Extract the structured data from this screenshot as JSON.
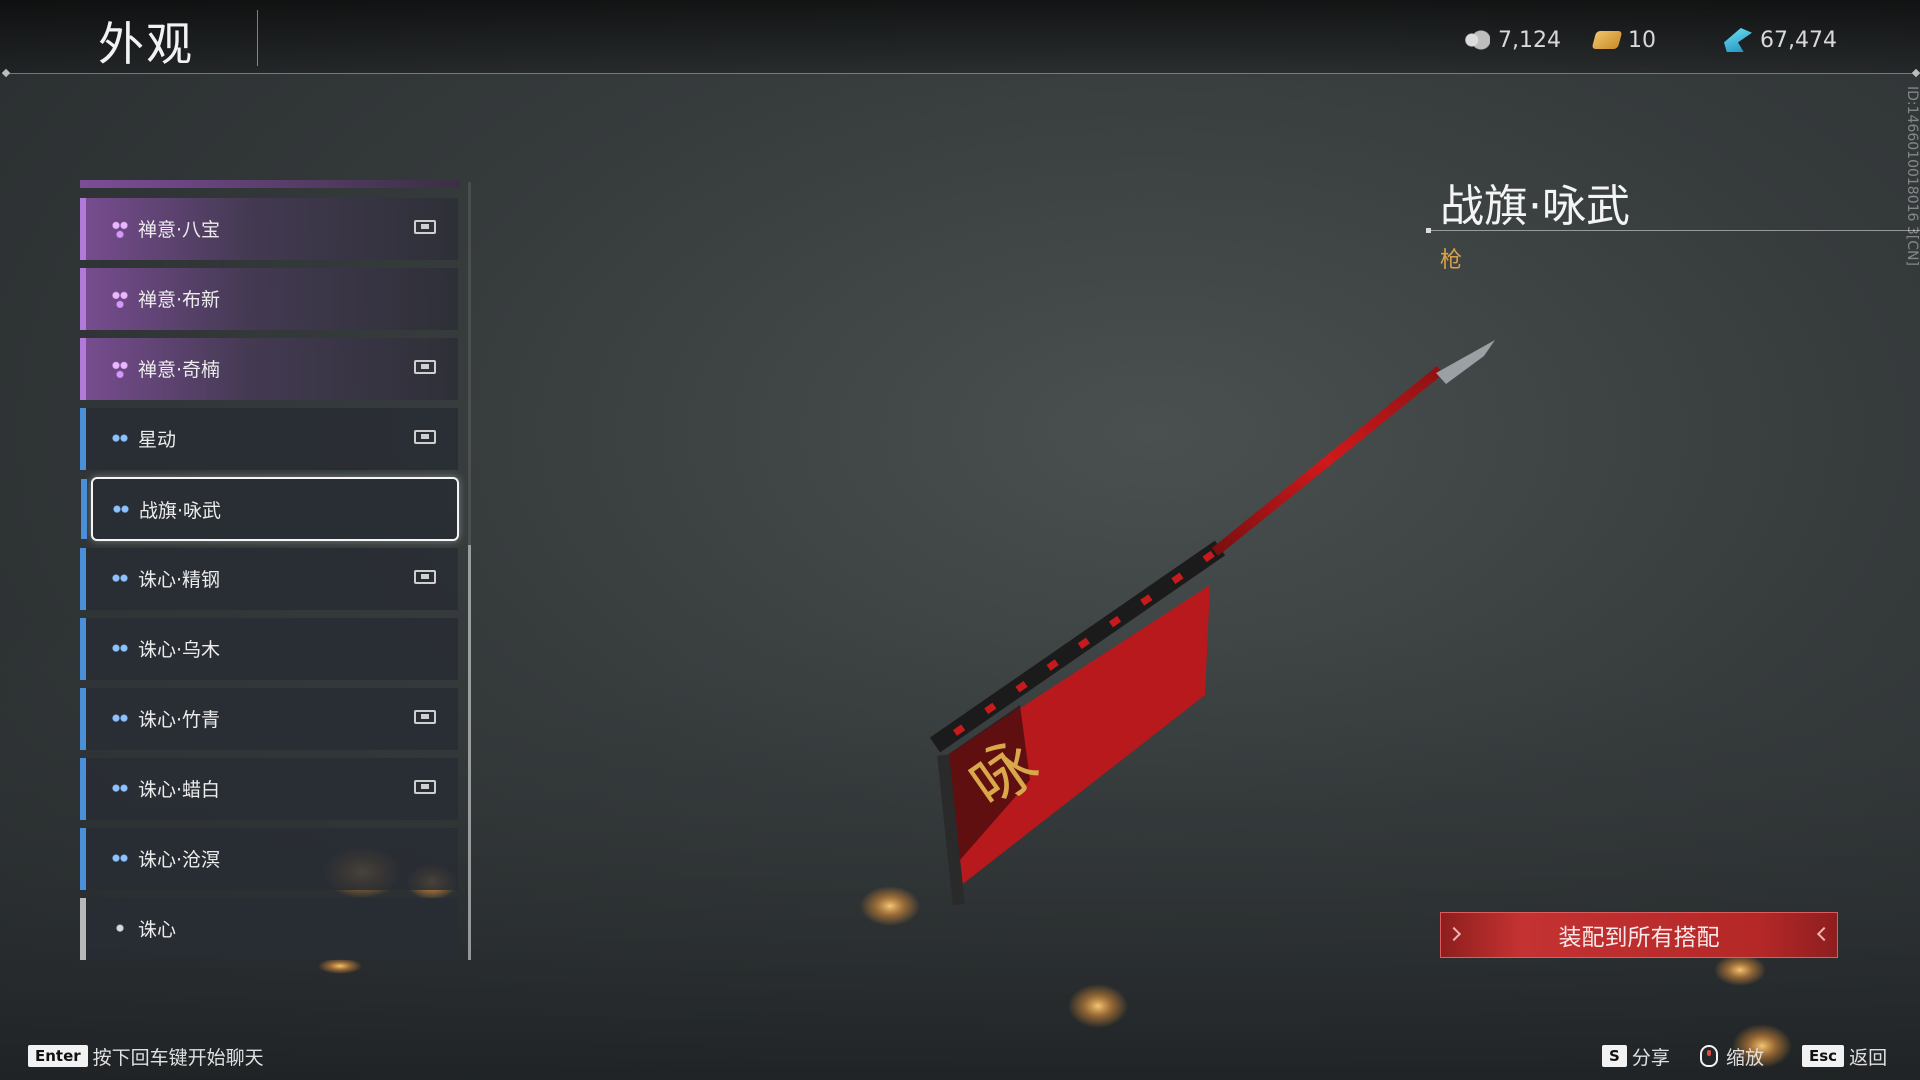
{
  "header": {
    "title": "外观"
  },
  "currencies": [
    {
      "icon": "silver-coin-icon",
      "value": "7,124"
    },
    {
      "icon": "gold-ingot-icon",
      "value": "10"
    },
    {
      "icon": "jade-feather-icon",
      "value": "67,474"
    }
  ],
  "list": {
    "items": [
      {
        "label": "禅意·八宝",
        "rarity": "purple",
        "locked": true
      },
      {
        "label": "禅意·布新",
        "rarity": "purple",
        "locked": false
      },
      {
        "label": "禅意·奇楠",
        "rarity": "purple",
        "locked": true
      },
      {
        "label": "星动",
        "rarity": "blue",
        "locked": true
      },
      {
        "label": "战旗·咏武",
        "rarity": "blue",
        "locked": false,
        "selected": true
      },
      {
        "label": "诛心·精钢",
        "rarity": "blue",
        "locked": true
      },
      {
        "label": "诛心·乌木",
        "rarity": "blue",
        "locked": false
      },
      {
        "label": "诛心·竹青",
        "rarity": "blue",
        "locked": true
      },
      {
        "label": "诛心·蜡白",
        "rarity": "blue",
        "locked": true
      },
      {
        "label": "诛心·沧溟",
        "rarity": "blue",
        "locked": false
      },
      {
        "label": "诛心",
        "rarity": "grey",
        "locked": false
      }
    ]
  },
  "detail": {
    "title": "战旗·咏武",
    "type": "枪",
    "id_text": "ID:1466010018016 3[CN]"
  },
  "equip_button": {
    "label": "装配到所有搭配"
  },
  "bottom_bar": {
    "chat": {
      "key": "Enter",
      "label": "按下回车键开始聊天"
    },
    "share": {
      "key": "S",
      "label": "分享"
    },
    "zoom": {
      "label": "缩放"
    },
    "back": {
      "key": "Esc",
      "label": "返回"
    }
  },
  "colors": {
    "purple_rarity": "#b27ad8",
    "blue_rarity": "#4b8fd8",
    "grey_rarity": "#b8b8b8",
    "accent_red": "#c43232",
    "type_gold": "#d8a24a"
  }
}
